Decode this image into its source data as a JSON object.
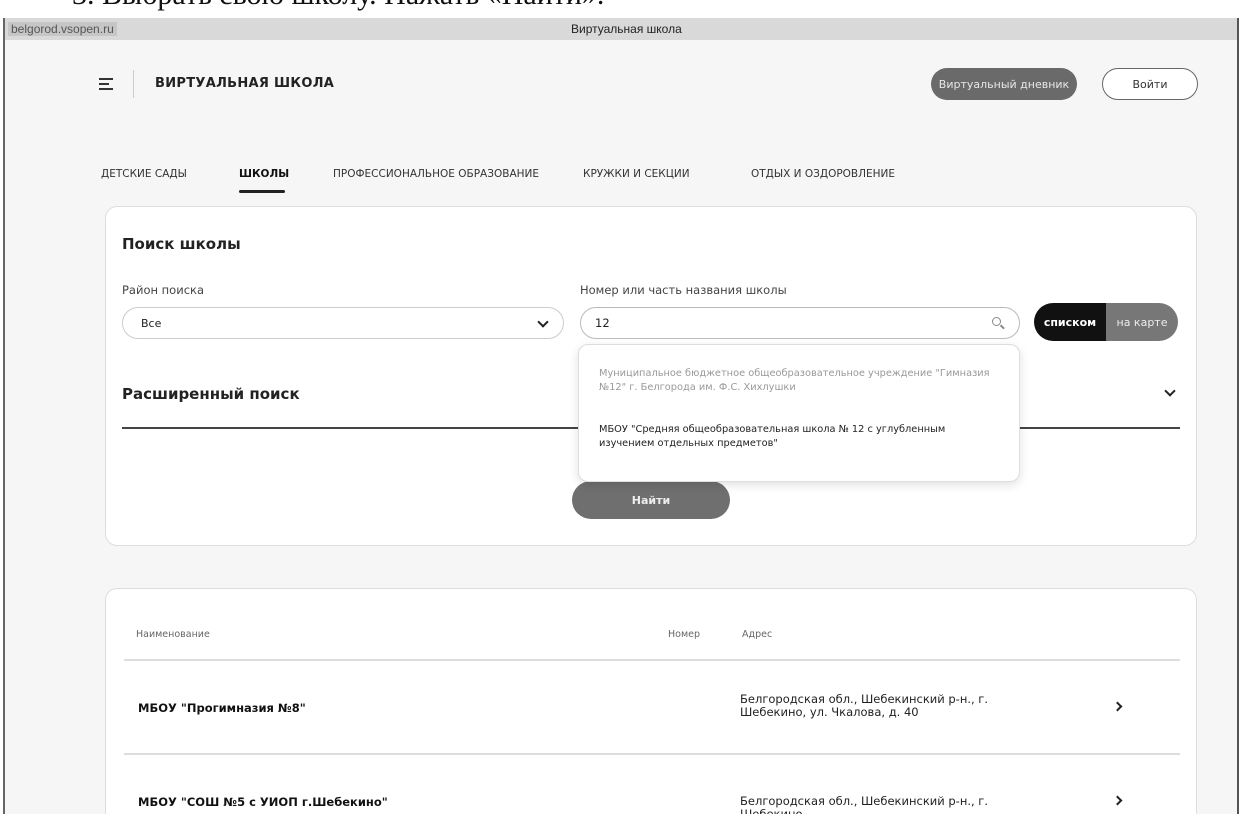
{
  "doc_caption": "3. Выбрать свою школу. Нажать «Найти».",
  "browser": {
    "url": "belgorod.vsopen.ru",
    "title": "Виртуальная школа"
  },
  "header": {
    "brand": "ВИРТУАЛЬНАЯ ШКОЛА",
    "diary_button": "Виртуальный дневник",
    "login_button": "Войти"
  },
  "tabs": [
    {
      "label": "ДЕТСКИЕ САДЫ",
      "active": false
    },
    {
      "label": "ШКОЛЫ",
      "active": true
    },
    {
      "label": "ПРОФЕССИОНАЛЬНОЕ ОБРАЗОВАНИЕ",
      "active": false
    },
    {
      "label": "КРУЖКИ И СЕКЦИИ",
      "active": false
    },
    {
      "label": "ОТДЫХ И ОЗДОРОВЛЕНИЕ",
      "active": false
    }
  ],
  "search": {
    "title": "Поиск школы",
    "district_label": "Район поиска",
    "district_value": "Все",
    "name_label": "Номер или часть названия школы",
    "name_value": "12",
    "view_list": "списком",
    "view_map": "на карте",
    "advanced_title": "Расширенный поиск",
    "find_button": "Найти"
  },
  "suggestions": [
    {
      "text": "Муниципальное бюджетное общеобразовательное учреждение \"Гимназия №12\" г. Белгорода им. Ф.С. Хихлушки",
      "muted": true
    },
    {
      "text": "МБОУ \"Средняя общеобразовательная школа № 12 с углубленным изучением отдельных предметов\"",
      "muted": false
    }
  ],
  "results": {
    "headers": {
      "name": "Наименование",
      "number": "Номер",
      "address": "Адрес"
    },
    "rows": [
      {
        "name": "МБОУ \"Прогимназия №8\"",
        "address": "Белгородская обл., Шебекинский р-н., г. Шебекино, ул. Чкалова, д. 40"
      },
      {
        "name": "МБОУ \"СОШ №5 с УИОП г.Шебекино\"",
        "address": "Белгородская обл., Шебекинский р-н., г. Шебекино"
      }
    ]
  },
  "colors": {
    "toggle_active": "#111111",
    "toggle_inactive": "#777777",
    "button_dark": "#6a6a6a"
  },
  "icons": [
    "menu-icon",
    "chevron-down-icon",
    "search-icon",
    "chevron-right-icon"
  ]
}
